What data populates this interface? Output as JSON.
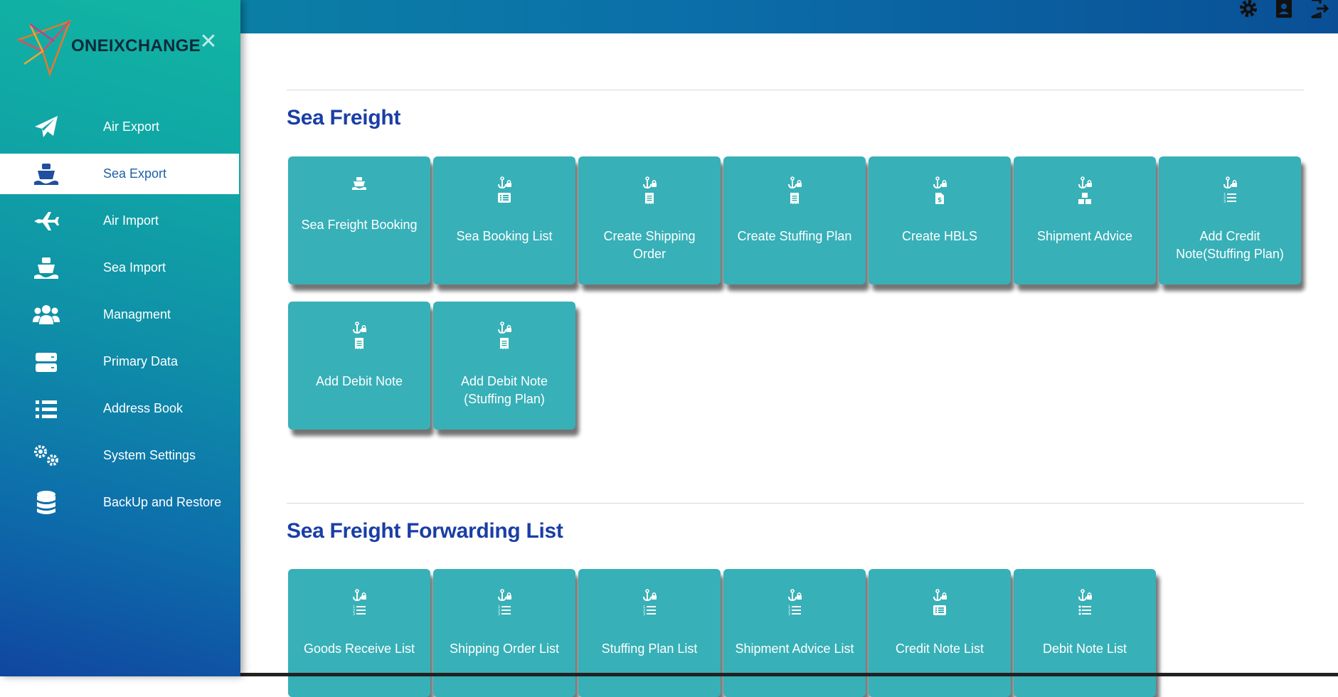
{
  "brand": {
    "name": "ONEIXCHANGE",
    "close_icon": "close-icon"
  },
  "topbar": {
    "icons": [
      "gear-icon",
      "user-card-icon",
      "logout-icon"
    ]
  },
  "sidebar": {
    "items": [
      {
        "label": "Air Export",
        "icon": "paper-plane-icon"
      },
      {
        "label": "Sea Export",
        "icon": "ship-icon",
        "active": true
      },
      {
        "label": "Air Import",
        "icon": "plane-icon"
      },
      {
        "label": "Sea Import",
        "icon": "ship-icon"
      },
      {
        "label": "Managment",
        "icon": "users-icon"
      },
      {
        "label": "Primary Data",
        "icon": "server-icon"
      },
      {
        "label": "Address Book",
        "icon": "list-icon"
      },
      {
        "label": "System Settings",
        "icon": "gears-icon"
      },
      {
        "label": "BackUp and Restore",
        "icon": "database-icon"
      }
    ]
  },
  "sections": [
    {
      "title": "Sea Freight",
      "tiles": [
        {
          "label": "Sea Freight Booking",
          "icons": [
            "ship-icon"
          ]
        },
        {
          "label": "Sea Booking List",
          "icons": [
            "anchor-lock-icon",
            "list-alt-icon"
          ]
        },
        {
          "label": "Create Shipping Order",
          "icons": [
            "anchor-lock-icon",
            "receipt-icon"
          ]
        },
        {
          "label": "Create Stuffing Plan",
          "icons": [
            "anchor-lock-icon",
            "receipt-icon"
          ]
        },
        {
          "label": "Create HBLS",
          "icons": [
            "anchor-lock-icon",
            "invoice-dollar-icon"
          ]
        },
        {
          "label": "Shipment Advice",
          "icons": [
            "anchor-lock-icon",
            "boxes-icon"
          ]
        },
        {
          "label": "Add Credit Note(Stuffing Plan)",
          "icons": [
            "anchor-lock-icon",
            "list-ol-icon"
          ]
        },
        {
          "label": "Add Debit Note",
          "icons": [
            "anchor-lock-icon",
            "receipt-icon"
          ]
        },
        {
          "label": "Add Debit Note (Stuffing Plan)",
          "icons": [
            "anchor-lock-icon",
            "receipt-icon"
          ]
        }
      ]
    },
    {
      "title": "Sea Freight Forwarding List",
      "tiles": [
        {
          "label": "Goods Receive List",
          "icons": [
            "anchor-lock-icon",
            "list-ol-icon"
          ]
        },
        {
          "label": "Shipping Order List",
          "icons": [
            "anchor-lock-icon",
            "list-ol-icon"
          ]
        },
        {
          "label": "Stuffing Plan List",
          "icons": [
            "anchor-lock-icon",
            "list-ol-icon"
          ]
        },
        {
          "label": "Shipment Advice List",
          "icons": [
            "anchor-lock-icon",
            "list-ol-icon"
          ]
        },
        {
          "label": "Credit Note List",
          "icons": [
            "anchor-lock-icon",
            "list-alt-icon"
          ]
        },
        {
          "label": "Debit Note List",
          "icons": [
            "anchor-lock-icon",
            "list-ul-icon"
          ]
        }
      ]
    }
  ],
  "colors": {
    "accent": "#1a3ea6",
    "tile": "#37b0b8",
    "sidebar_top": "#12b5a4",
    "sidebar_bottom": "#1046a0"
  }
}
